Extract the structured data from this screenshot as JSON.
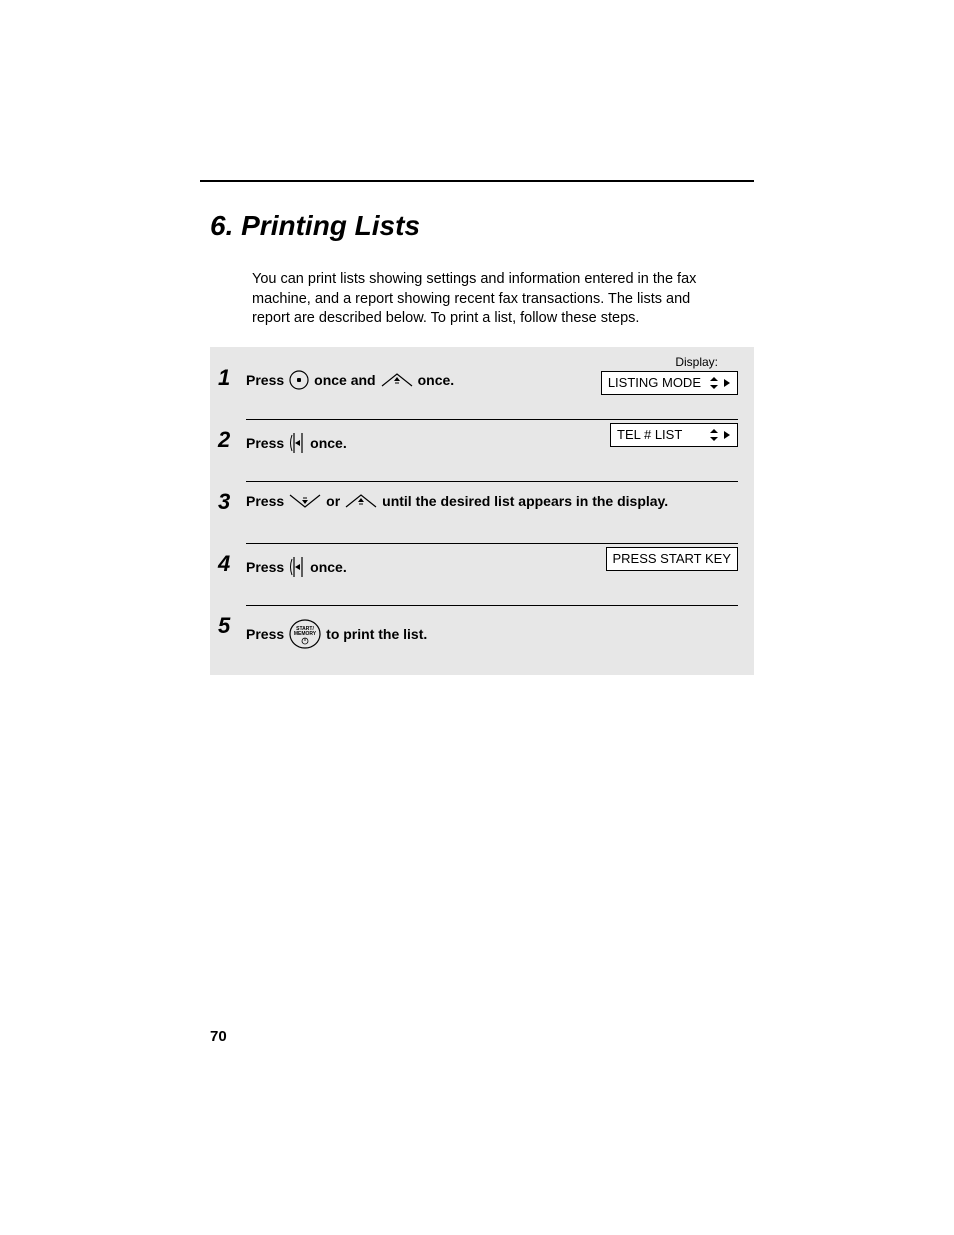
{
  "title": "6.  Printing Lists",
  "intro": "You can print lists showing settings and information entered in the fax machine, and a report showing recent fax transactions. The lists and report are described below. To print a list, follow these steps.",
  "displayLabel": "Display:",
  "steps": [
    {
      "num": "1",
      "parts": [
        "Press ",
        {
          "icon": "f-key"
        },
        " once and ",
        {
          "icon": "up-key"
        },
        " once."
      ],
      "lcd": "LISTING MODE",
      "lcdArrows": true
    },
    {
      "num": "2",
      "parts": [
        "Press ",
        {
          "icon": "right-key"
        },
        " once."
      ],
      "lcd": "TEL # LIST",
      "lcdArrows": true
    },
    {
      "num": "3",
      "parts": [
        "Press ",
        {
          "icon": "down-key"
        },
        " or ",
        {
          "icon": "up-key"
        },
        " until the desired list appears in the display."
      ]
    },
    {
      "num": "4",
      "parts": [
        "Press ",
        {
          "icon": "right-key"
        },
        " once."
      ],
      "lcd": "PRESS START KEY",
      "lcdArrows": false
    },
    {
      "num": "5",
      "parts": [
        "Press ",
        {
          "icon": "start-key"
        },
        " to print the list."
      ]
    }
  ],
  "pageNumber": "70",
  "icons": {
    "start-key-label": "START/\nMEMORY"
  }
}
